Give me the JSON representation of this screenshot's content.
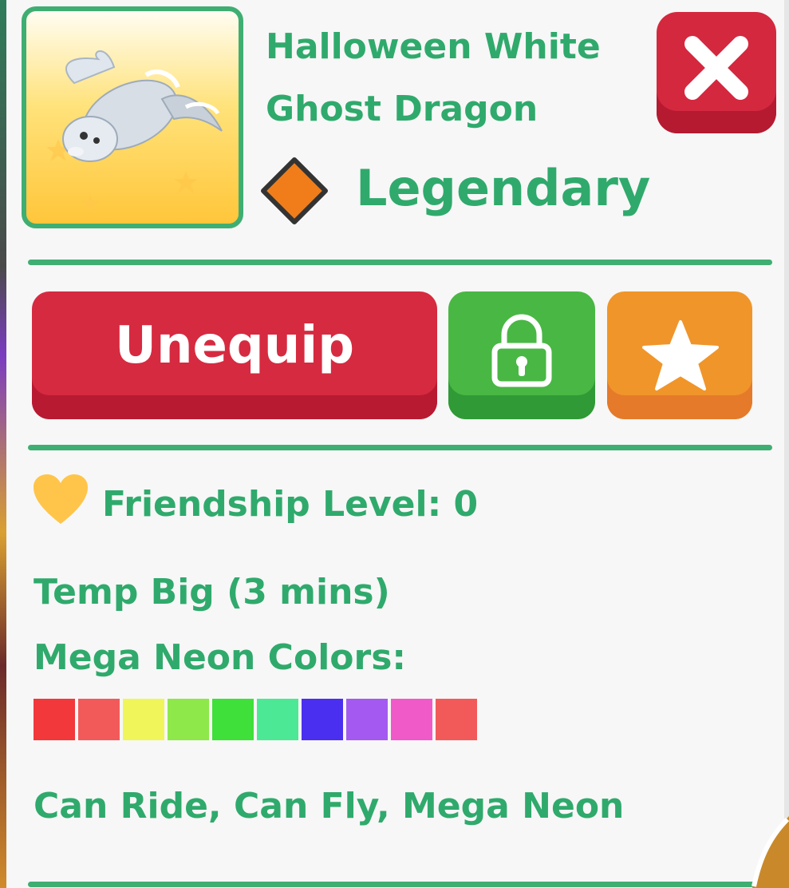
{
  "pet": {
    "name_line1": "Halloween White",
    "name_line2": "Ghost Dragon",
    "rarity": "Legendary",
    "rarity_color": "#f07d1a",
    "image_icon": "ghost-dragon-icon"
  },
  "actions": {
    "unequip_label": "Unequip",
    "lock_icon": "lock-icon",
    "favorite_icon": "star-icon",
    "close_icon": "close-icon"
  },
  "stats": {
    "friendship_label": "Friendship Level: 0",
    "temp_big": "Temp Big (3 mins)",
    "colors_label": "Mega Neon Colors:",
    "abilities": "Can Ride, Can Fly, Mega Neon"
  },
  "colors": {
    "accent": "#2faa6c",
    "neon_swatches": [
      "#f2383a",
      "#f25a5a",
      "#f0f55a",
      "#8ee84a",
      "#3fe03a",
      "#4de895",
      "#4b2ff0",
      "#a45af0",
      "#f05ac8",
      "#f25a5a"
    ]
  }
}
